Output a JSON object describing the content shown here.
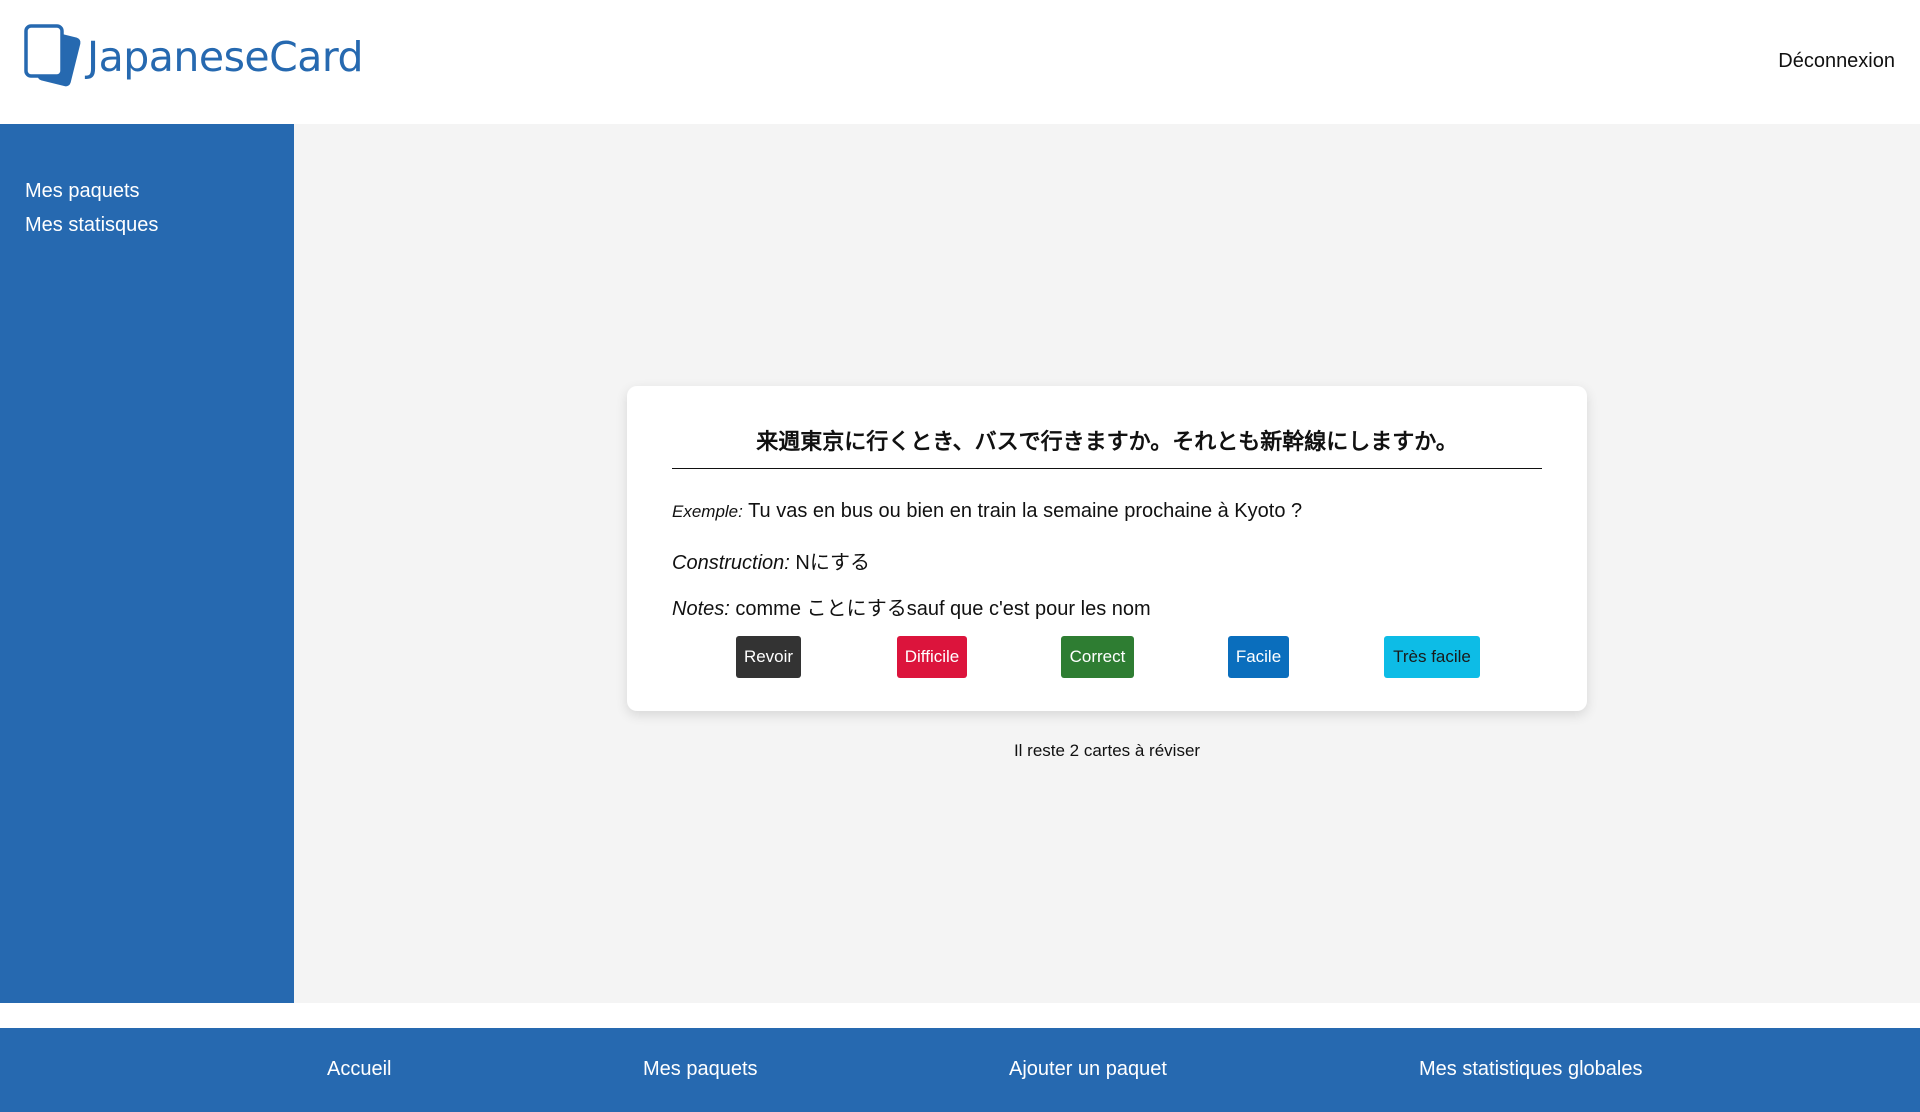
{
  "header": {
    "logo_text": "JapaneseCard",
    "logout_label": "Déconnexion"
  },
  "sidebar": {
    "items": [
      {
        "label": "Mes paquets"
      },
      {
        "label": "Mes statisques"
      }
    ]
  },
  "card": {
    "question": "来週東京に行くとき、バスで行きますか。それとも新幹線にしますか。",
    "example_label": "Exemple:",
    "example_value": "Tu vas en bus ou bien en train la semaine prochaine à Kyoto ?",
    "construction_label": "Construction:",
    "construction_value": "Nにする",
    "notes_label": "Notes:",
    "notes_value": "comme ことにするsauf que c'est pour les nom"
  },
  "buttons": [
    {
      "label": "Revoir",
      "color": "#333333"
    },
    {
      "label": "Difficile",
      "color": "#dc143c"
    },
    {
      "label": "Correct",
      "color": "#2e7d32"
    },
    {
      "label": "Facile",
      "color": "#0a6ebd"
    },
    {
      "label": "Très facile",
      "color": "#0dbce6"
    }
  ],
  "remaining_text": "Il reste 2 cartes à réviser",
  "footer": {
    "links": [
      {
        "label": "Accueil"
      },
      {
        "label": "Mes paquets"
      },
      {
        "label": "Ajouter un paquet"
      },
      {
        "label": "Mes statistiques globales"
      }
    ]
  },
  "colors": {
    "brand_blue": "#2669b0",
    "page_background": "#f4f4f4"
  }
}
